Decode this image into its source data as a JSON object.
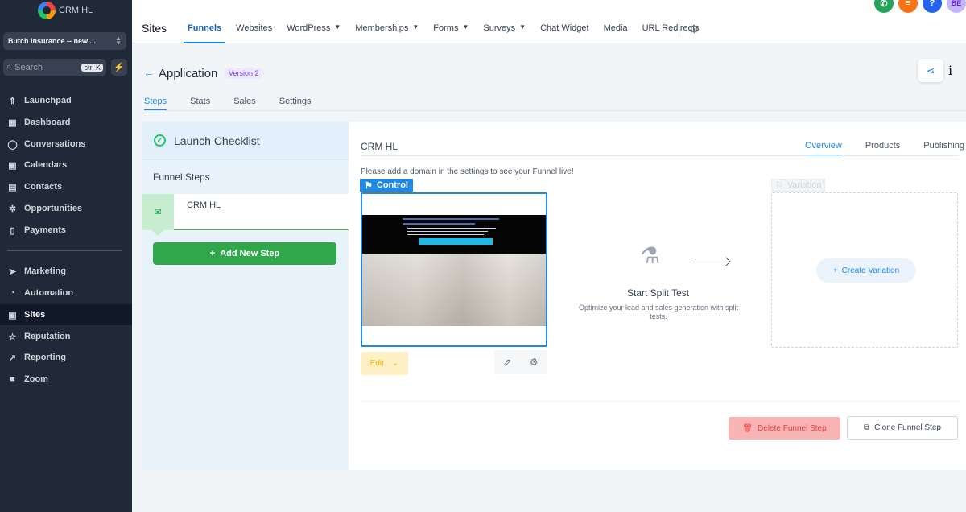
{
  "brand": {
    "name": "CRM HL"
  },
  "account": {
    "name": "Butch Insurance -- new ..."
  },
  "search": {
    "placeholder": "Search",
    "shortcut": "ctrl K"
  },
  "sidebar": {
    "items": [
      {
        "label": "Launchpad",
        "icon": "rocket-icon"
      },
      {
        "label": "Dashboard",
        "icon": "grid-icon"
      },
      {
        "label": "Conversations",
        "icon": "chat-icon"
      },
      {
        "label": "Calendars",
        "icon": "calendar-icon"
      },
      {
        "label": "Contacts",
        "icon": "contacts-icon"
      },
      {
        "label": "Opportunities",
        "icon": "opportunities-icon"
      },
      {
        "label": "Payments",
        "icon": "payments-icon"
      },
      {
        "label": "Marketing",
        "icon": "send-icon"
      },
      {
        "label": "Automation",
        "icon": "automation-icon"
      },
      {
        "label": "Sites",
        "icon": "sites-icon",
        "active": true
      },
      {
        "label": "Reputation",
        "icon": "star-icon"
      },
      {
        "label": "Reporting",
        "icon": "chart-icon"
      },
      {
        "label": "Zoom",
        "icon": "video-icon"
      }
    ]
  },
  "header": {
    "title": "Sites",
    "tabs": [
      {
        "label": "Funnels",
        "active": true
      },
      {
        "label": "Websites"
      },
      {
        "label": "WordPress",
        "dropdown": true
      },
      {
        "label": "Memberships",
        "dropdown": true
      },
      {
        "label": "Forms",
        "dropdown": true
      },
      {
        "label": "Surveys",
        "dropdown": true
      },
      {
        "label": "Chat Widget"
      },
      {
        "label": "Media"
      },
      {
        "label": "URL Redirects"
      }
    ],
    "avatar_initials": "BE"
  },
  "page": {
    "title": "Application",
    "version_badge": "Version 2",
    "tabs": [
      "Steps",
      "Stats",
      "Sales",
      "Settings"
    ],
    "active_tab": "Steps"
  },
  "left_panel": {
    "checklist_title": "Launch Checklist",
    "funnel_steps_label": "Funnel Steps",
    "steps": [
      {
        "name": "CRM HL"
      }
    ],
    "add_step_label": "Add New Step"
  },
  "main": {
    "step_title": "CRM HL",
    "tabs": [
      "Overview",
      "Products",
      "Publishing"
    ],
    "active_tab": "Overview",
    "domain_hint": "Please add a domain in the settings to see your Funnel live!",
    "control_label": "Control",
    "edit_label": "Edit",
    "split_title": "Start Split Test",
    "split_subtitle": "Optimize your lead and sales generation with split tests.",
    "variation_label": "Variation",
    "create_variation_label": "Create Variation",
    "delete_label": "Delete Funnel Step",
    "clone_label": "Clone Funnel Step"
  },
  "colors": {
    "accent": "#1e88e5",
    "sidebar_bg": "#1f2937",
    "success": "#2fa74a",
    "danger_bg": "#f8b4b4"
  }
}
